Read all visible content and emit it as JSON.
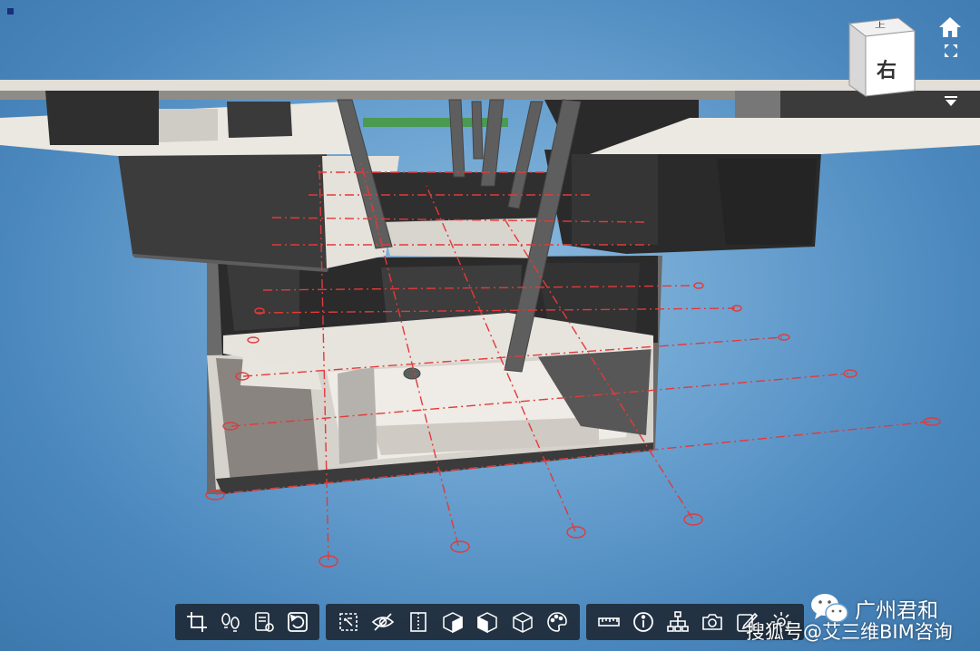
{
  "view_cube": {
    "top_face": "上",
    "right_face": "右"
  },
  "side_controls": [
    "home-icon",
    "fit-view-icon",
    "dropdown-arrow-icon"
  ],
  "toolbar": {
    "groups": [
      {
        "tools": [
          "crop-section-icon",
          "walk-footsteps-icon",
          "properties-document-icon",
          "reset-rotate-icon"
        ]
      },
      {
        "tools": [
          "box-select-icon",
          "eye-visibility-icon",
          "section-plane-icon",
          "cube-isolate-icon",
          "cube-hide-icon",
          "cube-wireframe-icon",
          "palette-icon"
        ]
      },
      {
        "tools": [
          "ruler-measure-icon",
          "info-icon",
          "tree-structure-icon",
          "camera-icon",
          "edit-markup-icon",
          "settings-icon"
        ]
      }
    ]
  },
  "watermark": {
    "name": "广州君和",
    "source": "搜狐号@艾三维BIM咨询"
  },
  "colors": {
    "background": "#5a95c9",
    "toolbar": "#1c242e",
    "grid_line": "#e23a3a",
    "slab": "#ece8e2",
    "wall": "#2e2e2e"
  }
}
